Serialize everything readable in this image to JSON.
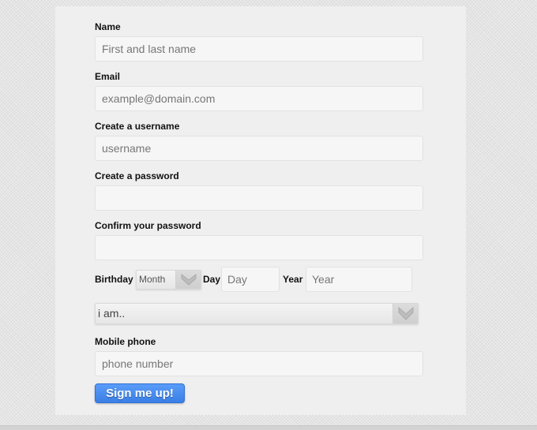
{
  "form": {
    "name": {
      "label": "Name",
      "placeholder": "First and last name",
      "value": ""
    },
    "email": {
      "label": "Email",
      "placeholder": "example@domain.com",
      "value": ""
    },
    "username": {
      "label": "Create a username",
      "placeholder": "username",
      "value": ""
    },
    "password": {
      "label": "Create a password",
      "placeholder": "",
      "value": ""
    },
    "confirm_password": {
      "label": "Confirm your password",
      "placeholder": "",
      "value": ""
    },
    "birthday": {
      "label": "Birthday",
      "month_selected": "Month",
      "day_label": "Day",
      "day_placeholder": "Day",
      "year_label": "Year",
      "year_placeholder": "Year"
    },
    "gender": {
      "selected": "i am.."
    },
    "mobile": {
      "label": "Mobile phone",
      "placeholder": "phone number",
      "value": ""
    },
    "submit_label": "Sign me up!"
  },
  "icons": {
    "dropdown": "chevron-down-icon"
  },
  "colors": {
    "button": "#3a7fe6",
    "panel": "#efefef",
    "background": "#e4e4e4"
  }
}
